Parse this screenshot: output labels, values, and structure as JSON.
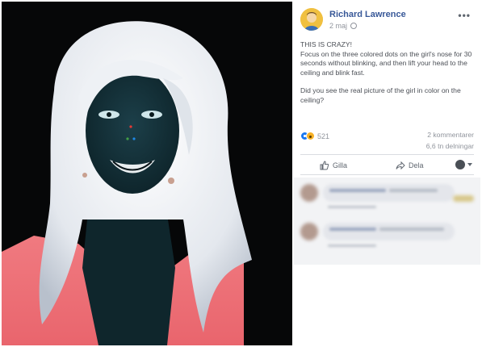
{
  "post": {
    "author": "Richard Lawrence",
    "date": "2 maj",
    "more_icon": "more-options-icon",
    "privacy_icon": "globe-icon",
    "text_line1": "THIS IS CRAZY!",
    "text_line2": "Focus on the three colored dots on the girl's nose for 30 seconds without blinking, and then lift your head to the ceiling and blink fast.",
    "text_question": "Did you see the real picture of the girl in color on the ceiling?"
  },
  "reactions": {
    "icons": [
      "like-reaction-icon",
      "wow-reaction-icon"
    ],
    "count": "521"
  },
  "stats": {
    "comments": "2 kommentarer",
    "shares": "6,6 tn delningar"
  },
  "actions": {
    "like_label": "Gilla",
    "share_label": "Dela"
  },
  "colors": {
    "brand_blue": "#385898",
    "like_blue": "#1877f2",
    "wow_yellow": "#f7b125",
    "text_gray": "#4b4f56",
    "muted_gray": "#90949c"
  }
}
